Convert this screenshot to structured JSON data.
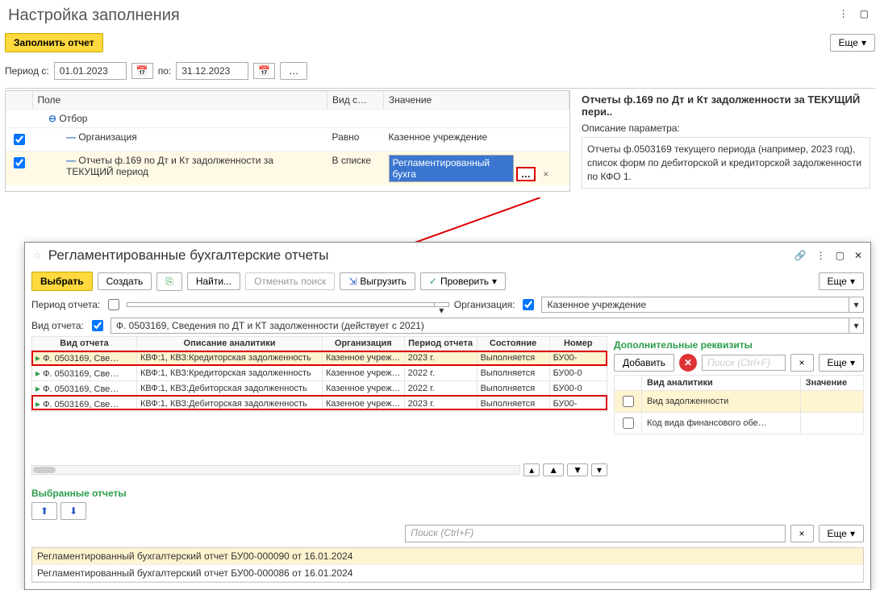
{
  "header": {
    "title": "Настройка заполнения",
    "fill_button": "Заполнить отчет",
    "more_button": "Еще"
  },
  "period": {
    "label_from": "Период с:",
    "date_from": "01.01.2023",
    "label_to": "по:",
    "date_to": "31.12.2023"
  },
  "filter_table": {
    "col_field": "Поле",
    "col_kind": "Вид с…",
    "col_value": "Значение",
    "group_label": "Отбор",
    "rows": [
      {
        "field": "Организация",
        "kind": "Равно",
        "value": "Казенное учреждение"
      },
      {
        "field": "Отчеты ф.169 по Дт и Кт задолженности за ТЕКУЩИЙ период",
        "kind": "В списке",
        "value": "Регламентированный бухга"
      }
    ]
  },
  "right_panel": {
    "title": "Отчеты ф.169 по Дт и Кт задолженности за ТЕКУЩИЙ пери..",
    "desc_label": "Описание параметра:",
    "desc_text": "Отчеты ф.0503169 текущего периода (например, 2023 год), список форм по дебиторской и кредиторской задолженности по КФО 1."
  },
  "dialog": {
    "title": "Регламентированные бухгалтерские отчеты",
    "btn_select": "Выбрать",
    "btn_create": "Создать",
    "btn_find": "Найти...",
    "btn_cancel_search": "Отменить поиск",
    "btn_export": "Выгрузить",
    "btn_check": "Проверить",
    "btn_more": "Еще",
    "filter_period_label": "Период отчета:",
    "filter_org_label": "Организация:",
    "filter_org_value": "Казенное учреждение",
    "filter_kind_label": "Вид отчета:",
    "filter_kind_value": "Ф. 0503169, Сведения по ДТ и КТ задолженности (действует с 2021)",
    "columns": {
      "kind": "Вид отчета",
      "analytics": "Описание аналитики",
      "org": "Организация",
      "period": "Период отчета",
      "state": "Состояние",
      "number": "Номер"
    },
    "rows": [
      {
        "kind": "Ф. 0503169, Све…",
        "analytics": "КВФ:1, КВЗ:Кредиторская задолженность",
        "org": "Казенное учреж…",
        "period": "2023 г.",
        "state": "Выполняется",
        "number": "БУ00-"
      },
      {
        "kind": "Ф. 0503169, Све…",
        "analytics": "КВФ:1, КВЗ:Кредиторская задолженность",
        "org": "Казенное учреж…",
        "period": "2022 г.",
        "state": "Выполняется",
        "number": "БУ00-0"
      },
      {
        "kind": "Ф. 0503169, Све…",
        "analytics": "КВФ:1, КВЗ:Дебиторская задолженность",
        "org": "Казенное учреж…",
        "period": "2022 г.",
        "state": "Выполняется",
        "number": "БУ00-0"
      },
      {
        "kind": "Ф. 0503169, Све…",
        "analytics": "КВФ:1, КВЗ:Дебиторская задолженность",
        "org": "Казенное учреж…",
        "period": "2023 г.",
        "state": "Выполняется",
        "number": "БУ00-"
      }
    ],
    "selected_title": "Выбранные отчеты",
    "search_placeholder": "Поиск (Ctrl+F)",
    "selected_items": [
      "Регламентированный бухгалтерский отчет БУ00-000090 от 16.01.2024",
      "Регламентированный бухгалтерский отчет БУ00-000086 от 16.01.2024"
    ],
    "req_title": "Дополнительные реквизиты",
    "btn_add": "Добавить",
    "req_columns": {
      "name": "Вид аналитики",
      "value": "Значение"
    },
    "req_rows": [
      {
        "name": "Вид задолженности",
        "value": ""
      },
      {
        "name": "Код вида финансового обе…",
        "value": ""
      }
    ]
  }
}
